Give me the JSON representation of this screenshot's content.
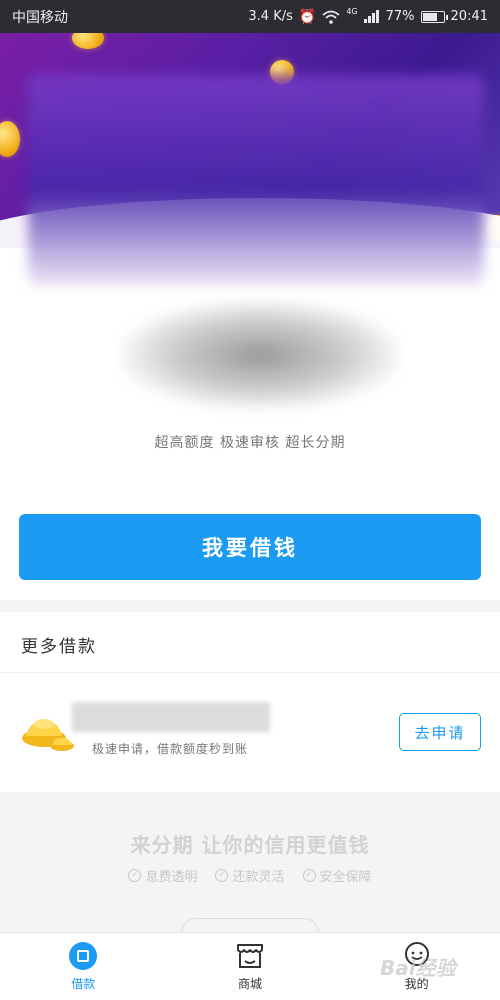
{
  "status_bar": {
    "carrier": "中国移动",
    "network_speed": "3.4 K/s",
    "signal_label": "4G",
    "battery_percent": "77%",
    "battery_level": 0.77,
    "time": "20:41"
  },
  "hero": {
    "tagline": "超高额度 极速审核 超长分期"
  },
  "main": {
    "borrow_button": "我要借钱"
  },
  "more_loans": {
    "title": "更多借款",
    "items": [
      {
        "description": "极速申请，借款额度秒到账",
        "apply_label": "去申请"
      }
    ]
  },
  "promo": {
    "title": "来分期 让你的信用更值钱",
    "features": [
      "息费透明",
      "还款灵活",
      "安全保障"
    ]
  },
  "bottom_nav": {
    "items": [
      {
        "label": "借款",
        "icon": "loan-icon",
        "active": true
      },
      {
        "label": "商城",
        "icon": "store-icon",
        "active": false
      },
      {
        "label": "我的",
        "icon": "profile-icon",
        "active": false
      }
    ]
  },
  "watermark": "Bai经验",
  "colors": {
    "accent": "#1a9af0",
    "status_bar": "#2b2d33",
    "hero_purple": "#5a1fa5"
  }
}
